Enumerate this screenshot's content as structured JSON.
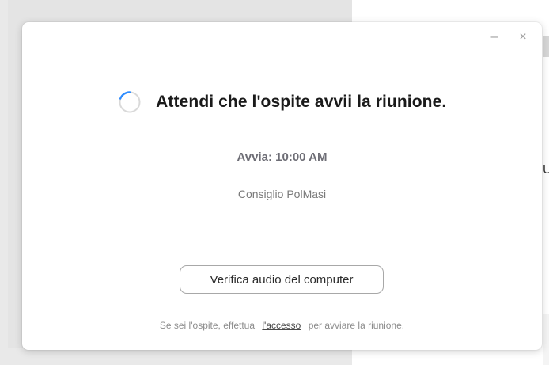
{
  "dialog": {
    "minimize_glyph": "–",
    "close_glyph": "×",
    "title": "Attendi che l'ospite avvii la riunione.",
    "start_time": "Avvia: 10:00 AM",
    "meeting_name": "Consiglio PolMasi",
    "audio_button_label": "Verifica audio del computer",
    "footer": {
      "prefix": "Se sei l'ospite, effettua",
      "link": "l'accesso",
      "suffix": "per avviare la riunione."
    }
  },
  "background": {
    "right_partial_letter": "U"
  },
  "colors": {
    "spinner_track": "#d9d9d9",
    "spinner_arc": "#2d8cff"
  }
}
